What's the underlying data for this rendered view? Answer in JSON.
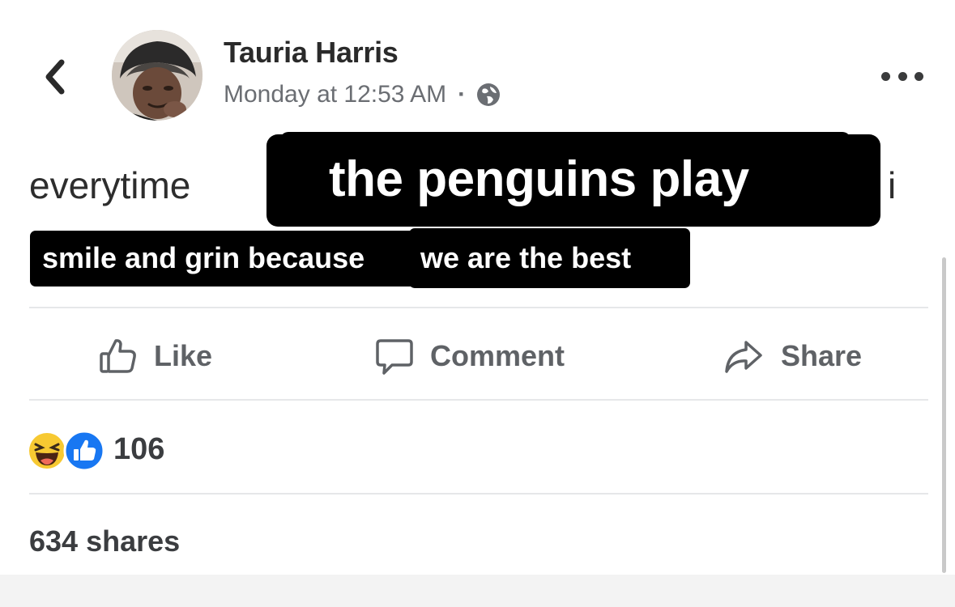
{
  "post": {
    "author_name": "Tauria Harris",
    "timestamp": "Monday at 12:53 AM",
    "meta_separator": "·",
    "audience_icon": "globe-icon",
    "body_prefix": "everytime",
    "body_suffix": "i"
  },
  "captions": {
    "large": "the penguins play",
    "small_left": "smile and grin because",
    "small_right": "we are the best"
  },
  "actions": {
    "like_label": "Like",
    "comment_label": "Comment",
    "share_label": "Share"
  },
  "stats": {
    "reaction_count": "106",
    "reaction_icons": [
      "haha-reaction-icon",
      "like-reaction-icon"
    ],
    "shares_text": "634 shares"
  },
  "theme": {
    "like_blue": "#1877f2",
    "haha_yellow": "#f7c932",
    "caption_background": "#000000",
    "action_gray": "#5f6266"
  }
}
